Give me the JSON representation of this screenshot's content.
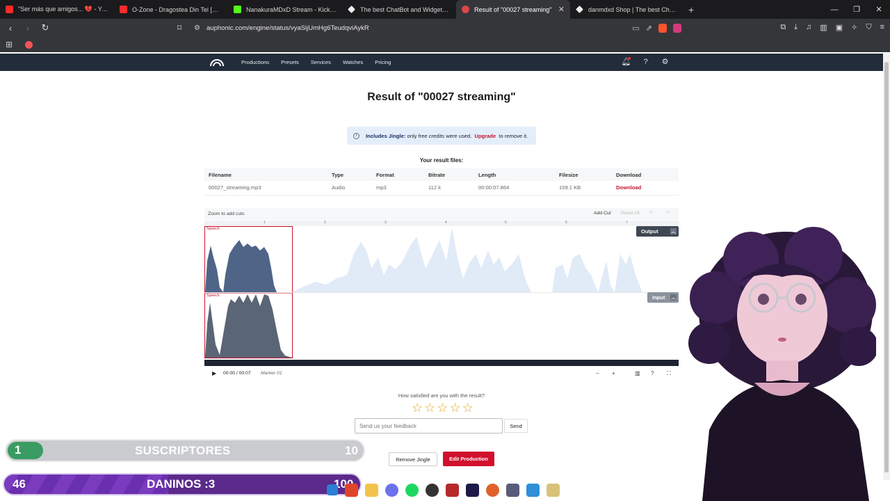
{
  "browser": {
    "tabs": [
      {
        "title": "\"Ser más que amigos... 💔 - YouTube",
        "color": "#ff2a2a"
      },
      {
        "title": "O-Zone - Dragostea Din Tei [Official V",
        "color": "#ff2a2a"
      },
      {
        "title": "NanakuraMDxD Stream - Kick Dashb",
        "color": "#53fc18"
      },
      {
        "title": "The best ChatBot and Widgets fo",
        "color": "#eeeeee"
      },
      {
        "title": "Result of \"00027 streaming\"",
        "color": "#d94848"
      },
      {
        "title": "danmdxd Shop | The best ChatBot an",
        "color": "#eeeeee"
      }
    ],
    "url": "auphonic.com/engine/status/vyaSijUmHg6TeudqviAykR"
  },
  "site_nav": {
    "links": [
      "Productions",
      "Presets",
      "Services",
      "Watches",
      "Pricing"
    ]
  },
  "page": {
    "title": "Result of \"00027 streaming\"",
    "info": {
      "strong": "Includes Jingle:",
      "text1": " only free credits were used. ",
      "link": "Upgrade",
      "text2": " to remove it."
    },
    "results_label": "Your result files:",
    "table": {
      "headers": [
        "Filename",
        "Type",
        "Format",
        "Bitrate",
        "Length",
        "Filesize",
        "Download"
      ],
      "rows": [
        [
          "00027_streaming.mp3",
          "Audio",
          "mp3",
          "112 k",
          "00:00:07.864",
          "109.1 KB",
          "Download"
        ]
      ]
    }
  },
  "editor": {
    "zoom_label": "Zoom to add cuts",
    "add_cut": "Add Cut",
    "reset_all": "Reset All",
    "ruler_ticks": [
      "1",
      "2",
      "3",
      "4",
      "5",
      "6",
      "7"
    ],
    "speech_label": "Speech",
    "output_label": "Output",
    "input_label": "Input",
    "time": "00:00 / 00:07",
    "marker": "Marker 01"
  },
  "feedback": {
    "question": "How satisfied are you with the result?",
    "stars": "☆☆☆☆☆",
    "placeholder": "Send us your feedback",
    "send": "Send"
  },
  "actions": {
    "remove_jingle": "Remove Jingle",
    "edit_production": "Edit Production"
  },
  "overlay": {
    "subs": {
      "current": "1",
      "label": "SUSCRIPTORES",
      "goal": "10",
      "progress": 0.1
    },
    "danninos": {
      "current": "46",
      "label": "DANINOS :3",
      "goal": "100",
      "progress": 0.46
    }
  },
  "colors": {
    "accent": "#d0102c",
    "nav": "#222c3a"
  }
}
